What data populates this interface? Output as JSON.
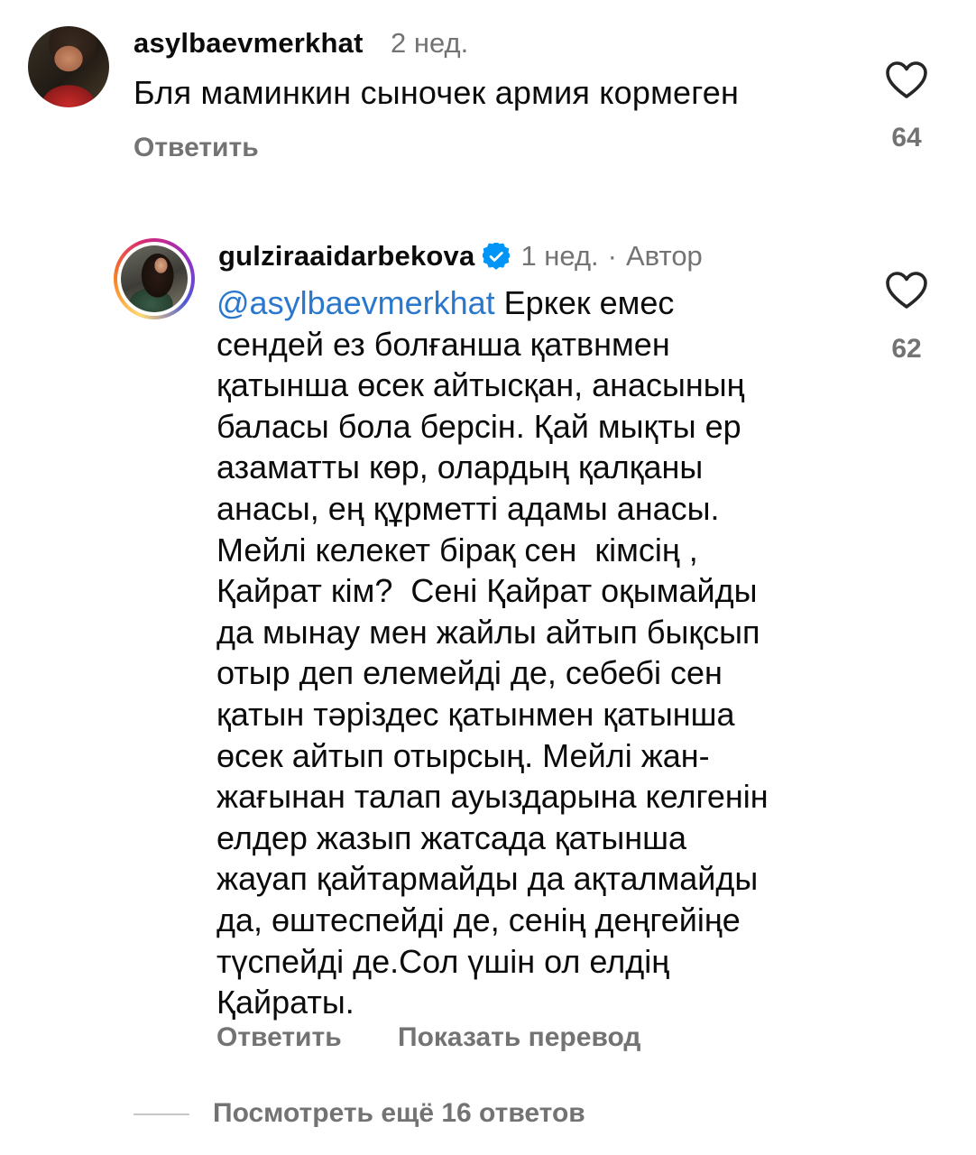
{
  "comment1": {
    "username": "asylbaevmerkhat",
    "time": "2 нед.",
    "text": "Бля маминкин сыночек армия кормеген",
    "reply_label": "Ответить",
    "likes": "64",
    "like_icon": "heart-outline-icon"
  },
  "comment2": {
    "username": "gulziraaidarbekova",
    "verified_icon": "verified-badge-icon",
    "time": "1 нед.",
    "separator": "·",
    "author_label": "Автор",
    "mention": "@asylbaevmerkhat",
    "lines": [
      " Еркек емес",
      "сендей ез болғанша қатвнмен",
      "қатынша өсек айтысқан, анасының",
      "баласы бола берсін. Қай мықты ер",
      "азаматты көр, олардың қалқаны",
      "анасы, ең құрметті адамы анасы.",
      "Мейлі келекет бірақ сен  кімсің ,",
      "Қайрат кім?  Сені Қайрат оқымайды",
      "да мынау мен жайлы айтып бықсып",
      "отыр деп елемейді де, себебі сен",
      "қатын тәріздес қатынмен қатынша",
      "өсек айтып отырсың. Мейлі жан-",
      "жағынан талап ауыздарына келгенін",
      "елдер жазып жатсада қатынша",
      "жауап қайтармайды да ақталмайды",
      "да, өштеспейді де, сенің деңгейіңе",
      "түспейді де.Сол үшін ол елдің",
      "Қайраты."
    ],
    "reply_label": "Ответить",
    "translate_label": "Показать перевод",
    "likes": "62",
    "like_icon": "heart-outline-icon"
  },
  "view_more_label": "Посмотреть ещё 16 ответов",
  "colors": {
    "text": "#0b0b0b",
    "secondary": "#737373",
    "mention": "#2a78cd",
    "verified": "#0095f6"
  }
}
